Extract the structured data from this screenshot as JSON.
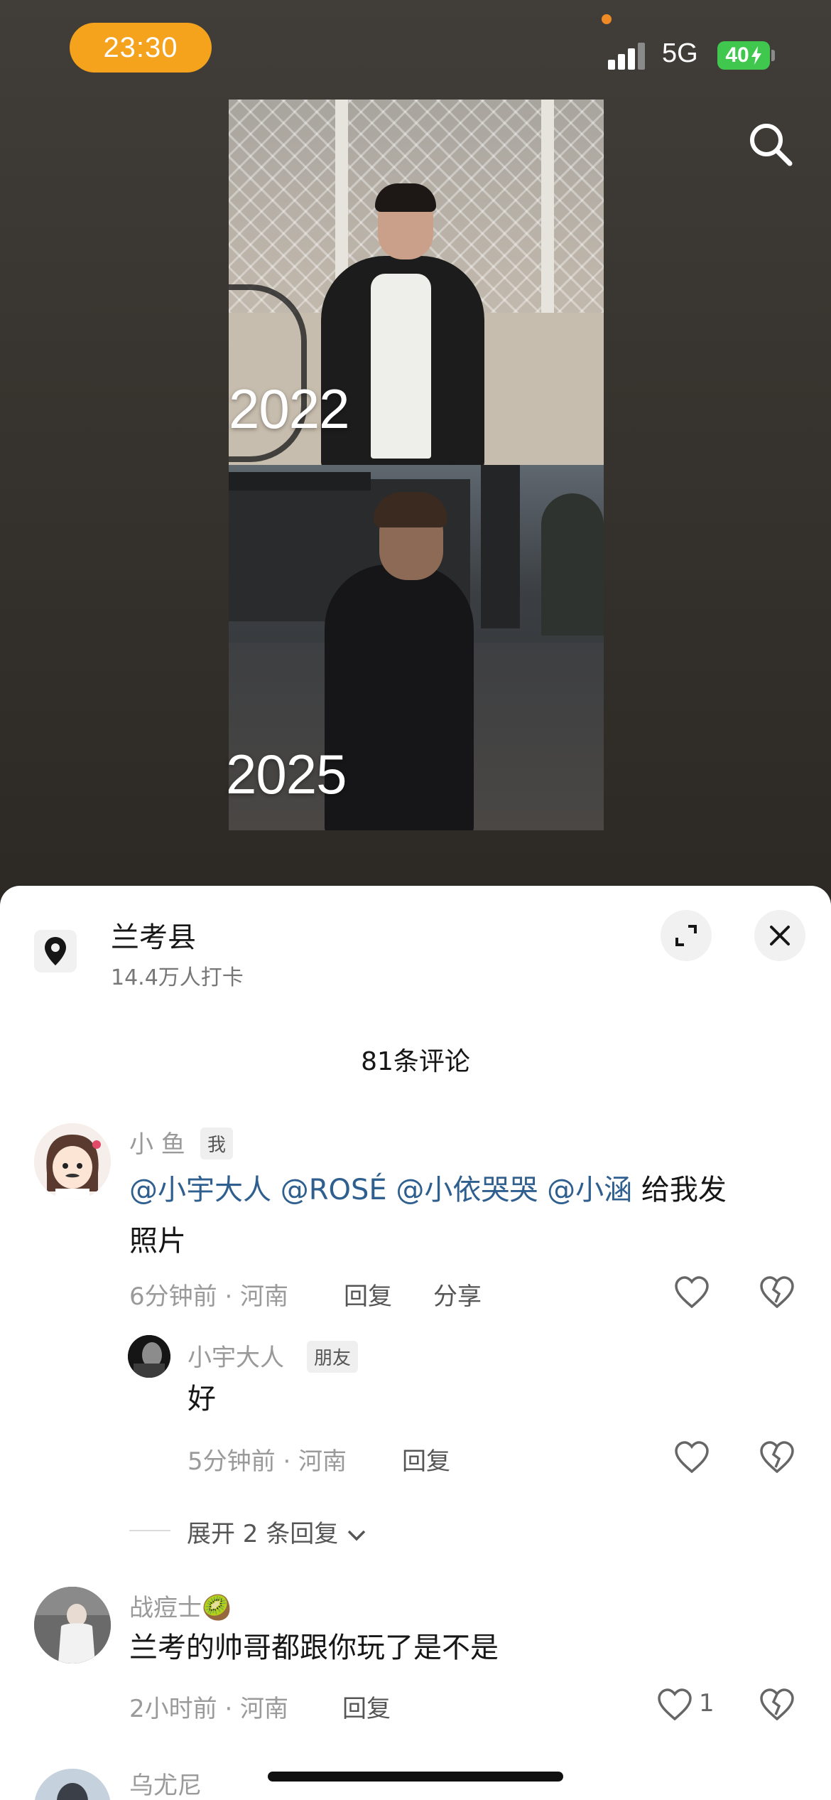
{
  "status_bar": {
    "time": "23:30",
    "network": "5G",
    "battery": "40",
    "colors": {
      "time_pill": "#f5a21c",
      "battery": "#3fc84d"
    }
  },
  "video": {
    "labels": [
      "2022",
      "2025"
    ],
    "search_icon": "search-icon"
  },
  "location": {
    "name": "兰考县",
    "checkins": "14.4万人打卡",
    "icon": "location-pin-icon"
  },
  "comments_header": {
    "count_label": "81条评论"
  },
  "comments": [
    {
      "user": "小 鱼",
      "tag": "我",
      "mentions": [
        "@小宇大人",
        "@ROSÉ",
        "@小依哭哭",
        "@小涵"
      ],
      "text_rest_1": "给我发",
      "text_rest_2": "照片",
      "meta": "6分钟前 · 河南",
      "reply": "回复",
      "share": "分享"
    },
    {
      "user": "小宇大人",
      "tag": "朋友",
      "text": "好",
      "meta": "5分钟前 · 河南",
      "reply": "回复"
    },
    {
      "user": "战痘士🥝",
      "text": "兰考的帅哥都跟你玩了是不是",
      "meta": "2小时前 · 河南",
      "reply": "回复",
      "likes": "1"
    },
    {
      "user": "乌尤尼"
    }
  ],
  "expand_replies": "展开 2 条回复"
}
